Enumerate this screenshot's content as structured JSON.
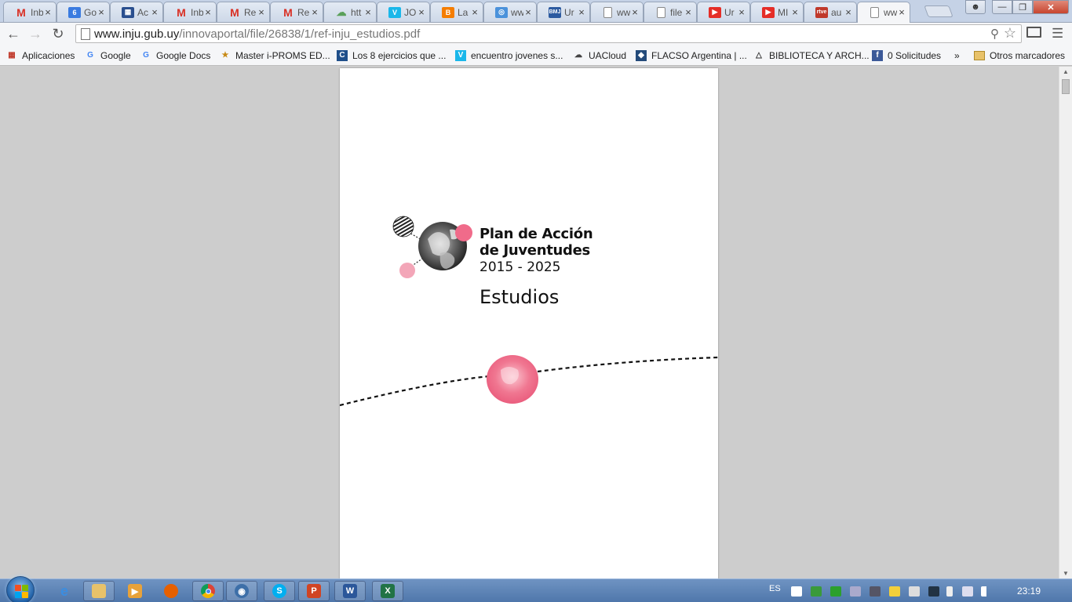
{
  "window": {
    "tabs": [
      {
        "icon": "gmail-icon",
        "label": "Inb",
        "color": "#d93025",
        "glyph": "M"
      },
      {
        "icon": "calendar-icon",
        "label": "Go",
        "color": "#3a7be0",
        "glyph": "6"
      },
      {
        "icon": "sheets-icon",
        "label": "Ac",
        "color": "#2a4f8f",
        "glyph": "▦"
      },
      {
        "icon": "gmail-icon",
        "label": "Inb",
        "color": "#d93025",
        "glyph": "M"
      },
      {
        "icon": "gmail-icon",
        "label": "Re",
        "color": "#d93025",
        "glyph": "M"
      },
      {
        "icon": "gmail-icon",
        "label": "Re",
        "color": "#d93025",
        "glyph": "M"
      },
      {
        "icon": "cloud-icon",
        "label": "htt",
        "color": "#5aa05a",
        "glyph": "☁"
      },
      {
        "icon": "vimeo-icon",
        "label": "JO",
        "color": "#1ab7ea",
        "glyph": "V"
      },
      {
        "icon": "blogger-icon",
        "label": "La",
        "color": "#f57d00",
        "glyph": "B"
      },
      {
        "icon": "un-icon",
        "label": "ww",
        "color": "#4b92db",
        "glyph": "◎"
      },
      {
        "icon": "bmj-icon",
        "label": "Ur",
        "color": "#2c5aa0",
        "glyph": "BMJ"
      },
      {
        "icon": "page-icon",
        "label": "ww",
        "color": "#ffffff",
        "glyph": ""
      },
      {
        "icon": "page-icon",
        "label": "file",
        "color": "#ffffff",
        "glyph": ""
      },
      {
        "icon": "youtube-icon",
        "label": "Ur",
        "color": "#e52d27",
        "glyph": "▶"
      },
      {
        "icon": "youtube-icon",
        "label": "MI",
        "color": "#e52d27",
        "glyph": "▶"
      },
      {
        "icon": "rtve-icon",
        "label": "au",
        "color": "#c0392b",
        "glyph": "rtve"
      },
      {
        "icon": "page-icon",
        "label": "ww",
        "color": "#ffffff",
        "glyph": "",
        "active": true
      }
    ],
    "close_glyph": "×"
  },
  "toolbar": {
    "url_host": "www.inju.gub.uy",
    "url_path": "/innovaportal/file/26838/1/ref-inju_estudios.pdf"
  },
  "bookmarks": [
    {
      "label": "Aplicaciones",
      "icon": "apps-grid-icon"
    },
    {
      "label": "Google",
      "icon": "google-icon"
    },
    {
      "label": "Google Docs",
      "icon": "google-icon"
    },
    {
      "label": "Master i-PROMS ED...",
      "icon": "folder-star-icon"
    },
    {
      "label": "Los 8 ejercicios que ...",
      "icon": "c-icon"
    },
    {
      "label": "encuentro jovenes s...",
      "icon": "vimeo-icon"
    },
    {
      "label": "UACloud",
      "icon": "cloud-icon"
    },
    {
      "label": "FLACSO Argentina | ...",
      "icon": "flacso-icon"
    },
    {
      "label": "BIBLIOTECA Y ARCH...",
      "icon": "biblioteca-icon"
    },
    {
      "label": "0 Solicitudes",
      "icon": "facebook-icon"
    },
    {
      "label": "»",
      "icon": ""
    },
    {
      "label": "Otros marcadores",
      "icon": "folder-icon"
    }
  ],
  "document": {
    "title_line1": "Plan de Acción",
    "title_line2": "de Juventudes",
    "title_years": "2015 - 2025",
    "subtitle": "Estudios",
    "accent_pink": "#f06b8a",
    "light_pink": "#f3a6b8"
  },
  "taskbar": {
    "language": "ES",
    "clock": "23:19"
  }
}
